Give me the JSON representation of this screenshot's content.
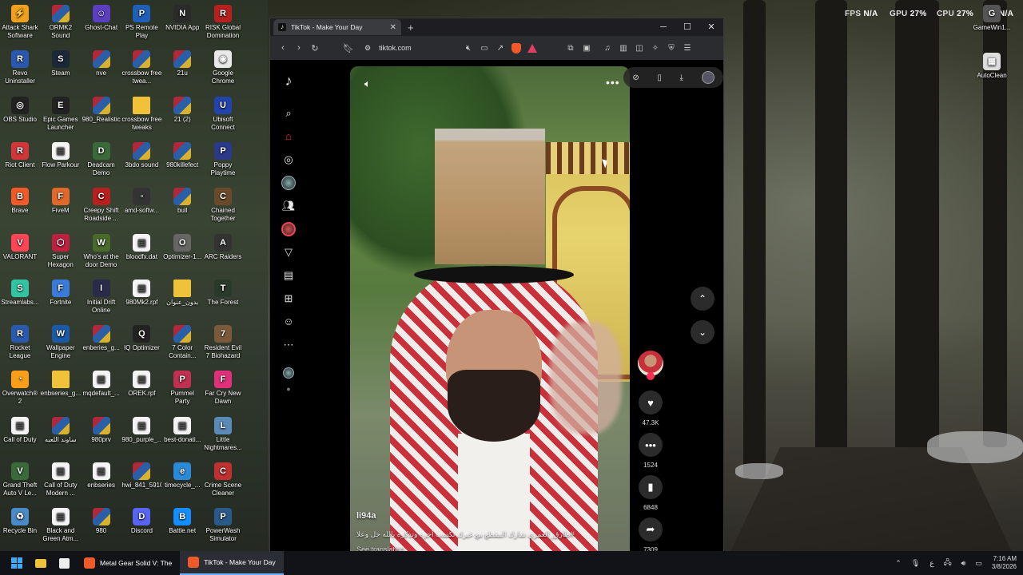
{
  "overlay": {
    "fps_label": "FPS",
    "fps_value": "N/A",
    "gpu_label": "GPU",
    "gpu_value": "27%",
    "cpu_label": "CPU",
    "cpu_value": "27%",
    "extra": "N/A"
  },
  "desktop_left": [
    {
      "label": "Attack Shark Software",
      "kind": "app",
      "color": "#f0a020",
      "glyph": "⚡"
    },
    {
      "label": "ORMK2 Sound",
      "kind": "rar"
    },
    {
      "label": "Ghost-Chat",
      "kind": "app",
      "color": "#5b3fc0",
      "glyph": "☺"
    },
    {
      "label": "PS Remote Play",
      "kind": "app",
      "color": "#1f5fb8",
      "glyph": "P"
    },
    {
      "label": "NVIDIA App",
      "kind": "app",
      "color": "#2a2a2a",
      "glyph": "N"
    },
    {
      "label": "RISK Global Domination",
      "kind": "app",
      "color": "#b82020",
      "glyph": "R"
    },
    {
      "label": "Revo Uninstaller",
      "kind": "app",
      "color": "#2a58b0",
      "glyph": "R"
    },
    {
      "label": "Steam",
      "kind": "app",
      "color": "#1b2838",
      "glyph": "S"
    },
    {
      "label": "nve",
      "kind": "rar"
    },
    {
      "label": "crossbow free twea...",
      "kind": "rar"
    },
    {
      "label": "21u",
      "kind": "rar"
    },
    {
      "label": "Google Chrome",
      "kind": "app",
      "color": "#e9e9e9",
      "glyph": "◉"
    },
    {
      "label": "OBS Studio",
      "kind": "app",
      "color": "#222",
      "glyph": "◎"
    },
    {
      "label": "Epic Games Launcher",
      "kind": "app",
      "color": "#222",
      "glyph": "E"
    },
    {
      "label": "980_Realistic",
      "kind": "rar"
    },
    {
      "label": "crossbow free tweaks",
      "kind": "folder"
    },
    {
      "label": "21 (2)",
      "kind": "rar"
    },
    {
      "label": "Ubisoft Connect",
      "kind": "app",
      "color": "#2244aa",
      "glyph": "U"
    },
    {
      "label": "Riot Client",
      "kind": "app",
      "color": "#d13639",
      "glyph": "R"
    },
    {
      "label": "Flow Parkour",
      "kind": "doc"
    },
    {
      "label": "Deadcam Demo",
      "kind": "app",
      "color": "#3a6a3a",
      "glyph": "D"
    },
    {
      "label": "3bdo sound",
      "kind": "rar"
    },
    {
      "label": "980killefect",
      "kind": "rar"
    },
    {
      "label": "Poppy Playtime",
      "kind": "app",
      "color": "#2a3a8a",
      "glyph": "P"
    },
    {
      "label": "Brave",
      "kind": "app",
      "color": "#f05a28",
      "glyph": "B"
    },
    {
      "label": "FiveM",
      "kind": "app",
      "color": "#e0682a",
      "glyph": "F"
    },
    {
      "label": "Creepy Shift Roadside ...",
      "kind": "app",
      "color": "#b82020",
      "glyph": "C"
    },
    {
      "label": "amd-softw...",
      "kind": "app",
      "color": "#333",
      "glyph": "▫"
    },
    {
      "label": "bull",
      "kind": "rar"
    },
    {
      "label": "Chained Together",
      "kind": "app",
      "color": "#6a4a2a",
      "glyph": "C"
    },
    {
      "label": "VALORANT",
      "kind": "app",
      "color": "#fd4556",
      "glyph": "V"
    },
    {
      "label": "Super Hexagon",
      "kind": "app",
      "color": "#c02040",
      "glyph": "⬡"
    },
    {
      "label": "Who's at the door Demo",
      "kind": "app",
      "color": "#4a6a2a",
      "glyph": "W"
    },
    {
      "label": "bloodfx.dat",
      "kind": "doc"
    },
    {
      "label": "Optimizer-1...",
      "kind": "app",
      "color": "#666",
      "glyph": "O"
    },
    {
      "label": "ARC Raiders",
      "kind": "app",
      "color": "#333",
      "glyph": "A"
    },
    {
      "label": "Streamlabs...",
      "kind": "app",
      "color": "#31c3a2",
      "glyph": "S"
    },
    {
      "label": "Fortnite",
      "kind": "app",
      "color": "#3a7ad8",
      "glyph": "F"
    },
    {
      "label": "Initial Drift Online",
      "kind": "app",
      "color": "#2a2a4a",
      "glyph": "I"
    },
    {
      "label": "980Mk2.rpf",
      "kind": "doc"
    },
    {
      "label": "بدون_عنوان",
      "kind": "folder"
    },
    {
      "label": "The Forest",
      "kind": "app",
      "color": "#2a3a2a",
      "glyph": "T"
    },
    {
      "label": "Rocket League",
      "kind": "app",
      "color": "#2a5ab0",
      "glyph": "R"
    },
    {
      "label": "Wallpaper Engine",
      "kind": "app",
      "color": "#1a5aa8",
      "glyph": "W"
    },
    {
      "label": "enberies_g...",
      "kind": "rar"
    },
    {
      "label": "IQ Optimizer",
      "kind": "app",
      "color": "#222",
      "glyph": "Q"
    },
    {
      "label": "7 Color Contain...",
      "kind": "rar"
    },
    {
      "label": "Resident Evil 7 Biohazard",
      "kind": "app",
      "color": "#7a5a3a",
      "glyph": "7"
    },
    {
      "label": "Overwatch® 2",
      "kind": "app",
      "color": "#f99e1a",
      "glyph": "◔"
    },
    {
      "label": "enbseries_g...",
      "kind": "folder"
    },
    {
      "label": "mqdefault_...",
      "kind": "doc"
    },
    {
      "label": "OREK.rpf",
      "kind": "doc"
    },
    {
      "label": "Pummel Party",
      "kind": "app",
      "color": "#c03050",
      "glyph": "P"
    },
    {
      "label": "Far Cry New Dawn",
      "kind": "app",
      "color": "#e0307a",
      "glyph": "F"
    },
    {
      "label": "Call of Duty",
      "kind": "doc"
    },
    {
      "label": "ساوند اللعبه",
      "kind": "rar"
    },
    {
      "label": "980prv",
      "kind": "rar"
    },
    {
      "label": "980_purple_...",
      "kind": "doc"
    },
    {
      "label": "best-donati...",
      "kind": "doc"
    },
    {
      "label": "Little Nightmares...",
      "kind": "app",
      "color": "#5a8ab8",
      "glyph": "L"
    },
    {
      "label": "Grand Theft Auto V Le...",
      "kind": "app",
      "color": "#3a6a3a",
      "glyph": "V"
    },
    {
      "label": "Call of Duty Modern ...",
      "kind": "doc"
    },
    {
      "label": "enbseries",
      "kind": "doc"
    },
    {
      "label": "hwi_841_5910",
      "kind": "rar"
    },
    {
      "label": "timecycle_...",
      "kind": "app",
      "color": "#2a8ad8",
      "glyph": "e"
    },
    {
      "label": "Crime Scene Cleaner",
      "kind": "app",
      "color": "#c03030",
      "glyph": "C"
    },
    {
      "label": "Recycle Bin",
      "kind": "app",
      "color": "#4a8ac8",
      "glyph": "♻"
    },
    {
      "label": "Black and Green Atm...",
      "kind": "doc"
    },
    {
      "label": "980",
      "kind": "rar"
    },
    {
      "label": "Discord",
      "kind": "app",
      "color": "#5865f2",
      "glyph": "D"
    },
    {
      "label": "Battle.net",
      "kind": "app",
      "color": "#148eff",
      "glyph": "B"
    },
    {
      "label": "PowerWash Simulator",
      "kind": "app",
      "color": "#2a5a8a",
      "glyph": "P"
    }
  ],
  "desktop_right": [
    {
      "label": "GameWin1...",
      "kind": "app",
      "color": "#555",
      "glyph": "G"
    },
    {
      "label": "AutoClean",
      "kind": "app",
      "color": "#ddd",
      "glyph": "▦"
    }
  ],
  "browser": {
    "tab_title": "TikTok - Make Your Day",
    "url": "tiktok.com"
  },
  "video": {
    "username": "li94a",
    "description": "#طارق_العمري شارك المقطع مع غيرك تكسب أجره وتذكره بالله جل وعلا",
    "see_translation": "See translation",
    "likes": "47.3K",
    "comments": "1524",
    "saves": "6848",
    "shares": "7309"
  },
  "taskbar": {
    "apps": [
      {
        "label": "Metal Gear Solid V: The",
        "color": "#f05a28"
      },
      {
        "label": "TikTok - Make Your Day",
        "color": "#f05a28"
      }
    ],
    "lang": "ع",
    "time": "7:16 AM",
    "date": "3/8/2026"
  }
}
